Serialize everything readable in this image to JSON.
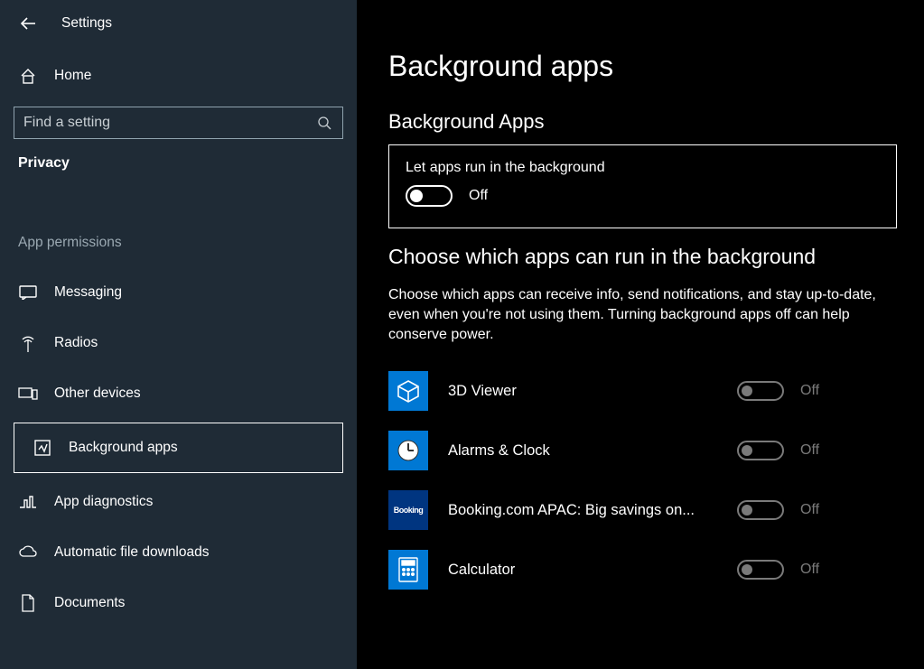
{
  "header": {
    "settings_title": "Settings",
    "home_label": "Home",
    "search_placeholder": "Find a setting",
    "section_label": "Privacy",
    "permissions_label": "App permissions"
  },
  "sidebar": {
    "items": [
      {
        "label": "Messaging",
        "icon": "message-icon"
      },
      {
        "label": "Radios",
        "icon": "radios-icon"
      },
      {
        "label": "Other devices",
        "icon": "devices-icon"
      },
      {
        "label": "Background apps",
        "icon": "background-apps-icon"
      },
      {
        "label": "App diagnostics",
        "icon": "diagnostics-icon"
      },
      {
        "label": "Automatic file downloads",
        "icon": "cloud-download-icon"
      },
      {
        "label": "Documents",
        "icon": "document-icon"
      }
    ]
  },
  "main": {
    "page_title": "Background apps",
    "section1_title": "Background Apps",
    "master_toggle_label": "Let apps run in the background",
    "master_toggle_state": "Off",
    "section2_title": "Choose which apps can run in the background",
    "description": "Choose which apps can receive info, send notifications, and stay up-to-date, even when you're not using them. Turning background apps off can help conserve power.",
    "apps": [
      {
        "name": "3D Viewer",
        "state": "Off",
        "icon": "cube-icon"
      },
      {
        "name": "Alarms & Clock",
        "state": "Off",
        "icon": "clock-icon"
      },
      {
        "name": "Booking.com APAC: Big savings on...",
        "state": "Off",
        "icon": "booking-icon"
      },
      {
        "name": "Calculator",
        "state": "Off",
        "icon": "calculator-icon"
      }
    ]
  }
}
